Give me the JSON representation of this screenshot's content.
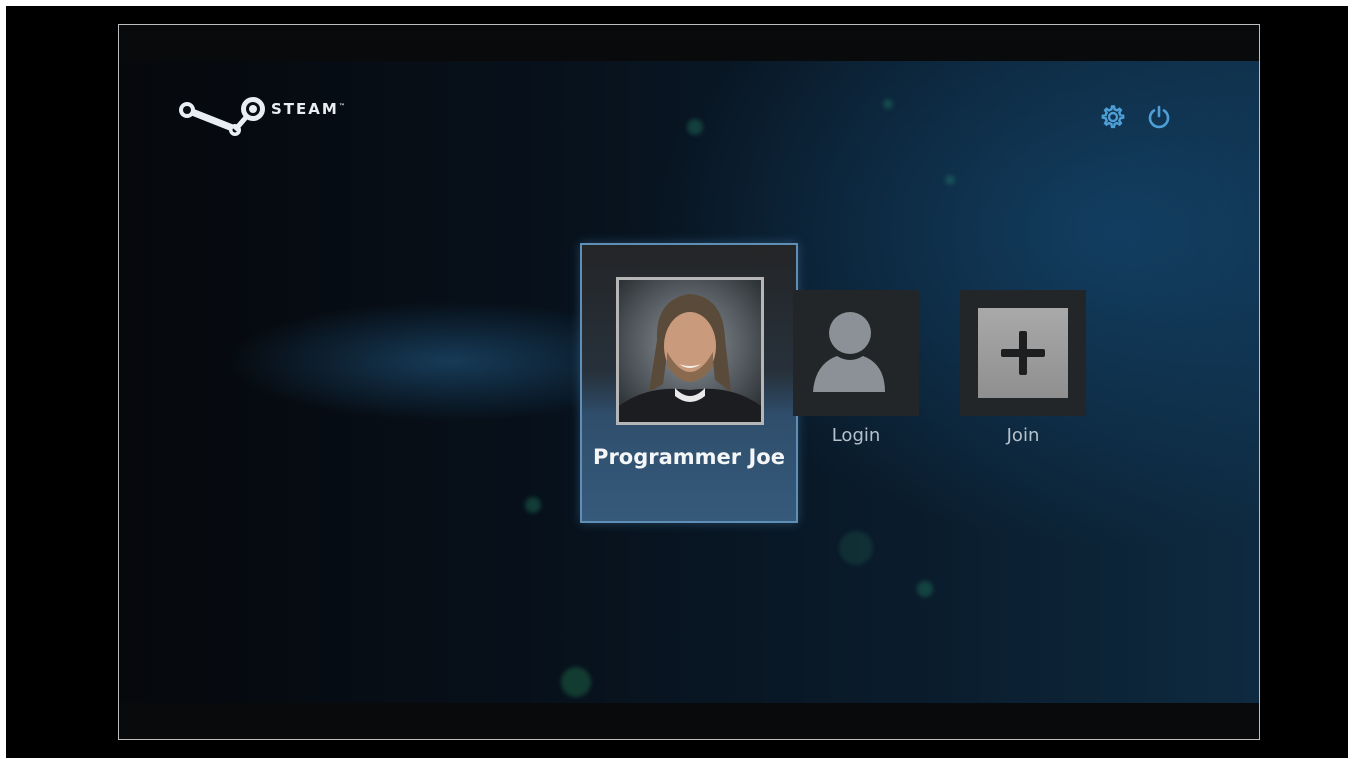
{
  "app": {
    "brand": "STEAM",
    "trademark": "™"
  },
  "toolbar": {
    "settings_icon": "gear-icon",
    "power_icon": "power-icon"
  },
  "profiles": {
    "selected": {
      "name": "Programmer Joe",
      "avatar": "user-photo"
    },
    "login": {
      "label": "Login",
      "icon": "person-silhouette-icon"
    },
    "join": {
      "label": "Join",
      "icon": "plus-icon"
    }
  },
  "colors": {
    "accent": "#4d9fd6",
    "selected_border": "#5f8fb7",
    "background_dark": "#06080c",
    "background_blue": "#0e2a40"
  }
}
